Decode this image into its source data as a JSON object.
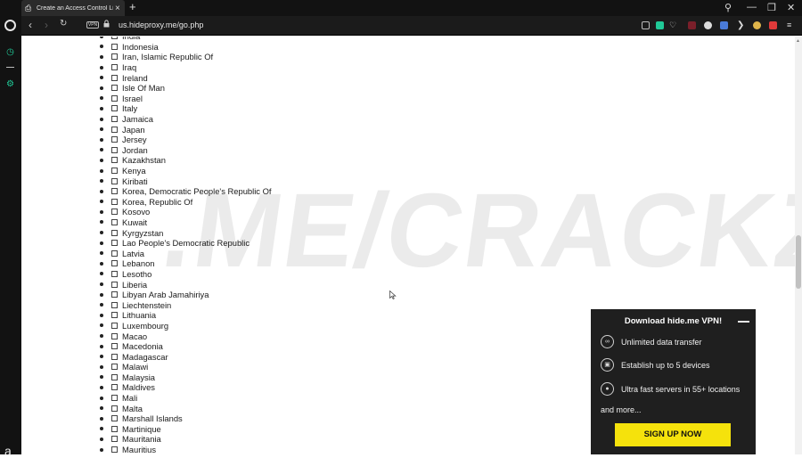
{
  "browser": {
    "tab_title": "Create an Access Control Li",
    "url": "us.hideproxy.me/go.php",
    "vpn_label": "VPN"
  },
  "countries": [
    "India",
    "Indonesia",
    "Iran, Islamic Republic Of",
    "Iraq",
    "Ireland",
    "Isle Of Man",
    "Israel",
    "Italy",
    "Jamaica",
    "Japan",
    "Jersey",
    "Jordan",
    "Kazakhstan",
    "Kenya",
    "Kiribati",
    "Korea, Democratic People's Republic Of",
    "Korea, Republic Of",
    "Kosovo",
    "Kuwait",
    "Kyrgyzstan",
    "Lao People's Democratic Republic",
    "Latvia",
    "Lebanon",
    "Lesotho",
    "Liberia",
    "Libyan Arab Jamahiriya",
    "Liechtenstein",
    "Lithuania",
    "Luxembourg",
    "Macao",
    "Macedonia",
    "Madagascar",
    "Malawi",
    "Malaysia",
    "Maldives",
    "Mali",
    "Malta",
    "Marshall Islands",
    "Martinique",
    "Mauritania",
    "Mauritius"
  ],
  "watermark": ".ME/CRACKZX",
  "popup": {
    "title": "Download hide.me VPN!",
    "features": [
      "Unlimited data transfer",
      "Establish up to 5 devices",
      "Ultra fast servers in 55+ locations"
    ],
    "more": "and more...",
    "cta": "SIGN UP NOW"
  },
  "sidebar": {
    "bottom_glyph": "a"
  },
  "colors": {
    "accent": "#20c997",
    "cta": "#f5e20c",
    "popup_bg": "#1f1f1f"
  }
}
